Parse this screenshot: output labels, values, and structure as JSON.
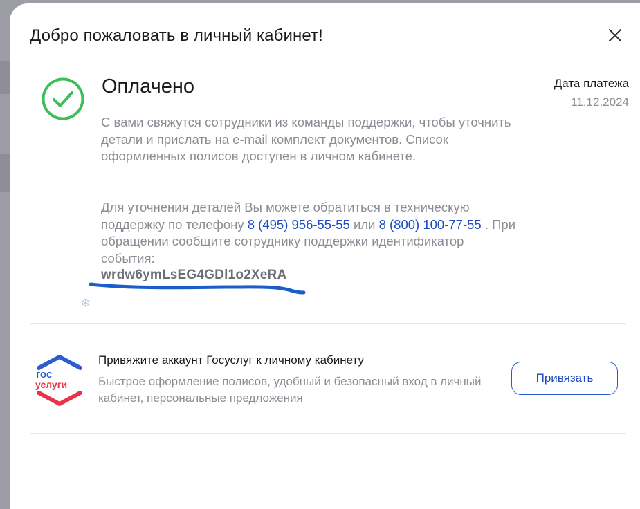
{
  "modal": {
    "title": "Добро пожаловать в личный кабинет!",
    "close_icon": "close-icon"
  },
  "payment": {
    "status_icon": "check-circle-icon",
    "status": "Оплачено",
    "status_color": "#3cbf5a",
    "date_label": "Дата платежа",
    "date_value": "11.12.2024",
    "paragraph1": "С вами свяжутся сотрудники из команды поддержки, чтобы уточнить детали и прислать на e-mail комплект документов. Список оформленных полисов доступен в личном кабинете.",
    "paragraph2": {
      "part1": "Для уточнения деталей Вы можете обратиться в техническую поддержку по телефону ",
      "phone1": "8 (495) 956-55-55",
      "part2": " или ",
      "phone2": "8 (800) 100-77-55",
      "part3": " . При обращении сообщите сотруднику поддержки идентификатор события:"
    },
    "event_id": "wrdw6ymLsEG4GDl1o2XeRA",
    "link_color": "#1a4bc4"
  },
  "gosuslugi": {
    "logo_line1": "гос",
    "logo_line2": "услуги",
    "logo_colors": {
      "blue": "#2d5bd0",
      "red": "#e8334a"
    },
    "title": "Привяжите аккаунт Госуслуг к личному кабинету",
    "description": "Быстрое оформление полисов, удобный и безопасный вход в личный кабинет, персональные предложения",
    "button_label": "Привязать"
  }
}
